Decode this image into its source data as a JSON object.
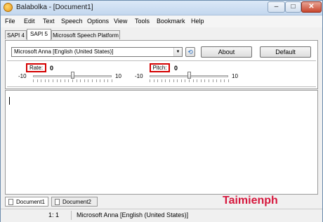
{
  "window": {
    "title": "Balabolka - [Document1]"
  },
  "menu": [
    "File",
    "Edit",
    "Text",
    "Speech",
    "Options",
    "View",
    "Tools",
    "Bookmark",
    "Help"
  ],
  "engine_tabs": [
    "SAPI 4",
    "SAPI 5",
    "Microsoft Speech Platform"
  ],
  "voice": {
    "selected": "Microsoft Anna [English (United States)]"
  },
  "buttons": {
    "about": "About",
    "default": "Default"
  },
  "rate": {
    "label": "Rate:",
    "value": "0",
    "min": "-10",
    "max": "10",
    "level": 0.5
  },
  "pitch": {
    "label": "Pitch:",
    "value": "0",
    "min": "-10",
    "max": "10",
    "level": 0.5
  },
  "doc_tabs": [
    "Document1",
    "Document2"
  ],
  "status": {
    "position": "1:   1",
    "voice": "Microsoft Anna [English (United States)]"
  },
  "watermark": {
    "text": "Taimienph",
    "brand_color": "#d4002a"
  }
}
